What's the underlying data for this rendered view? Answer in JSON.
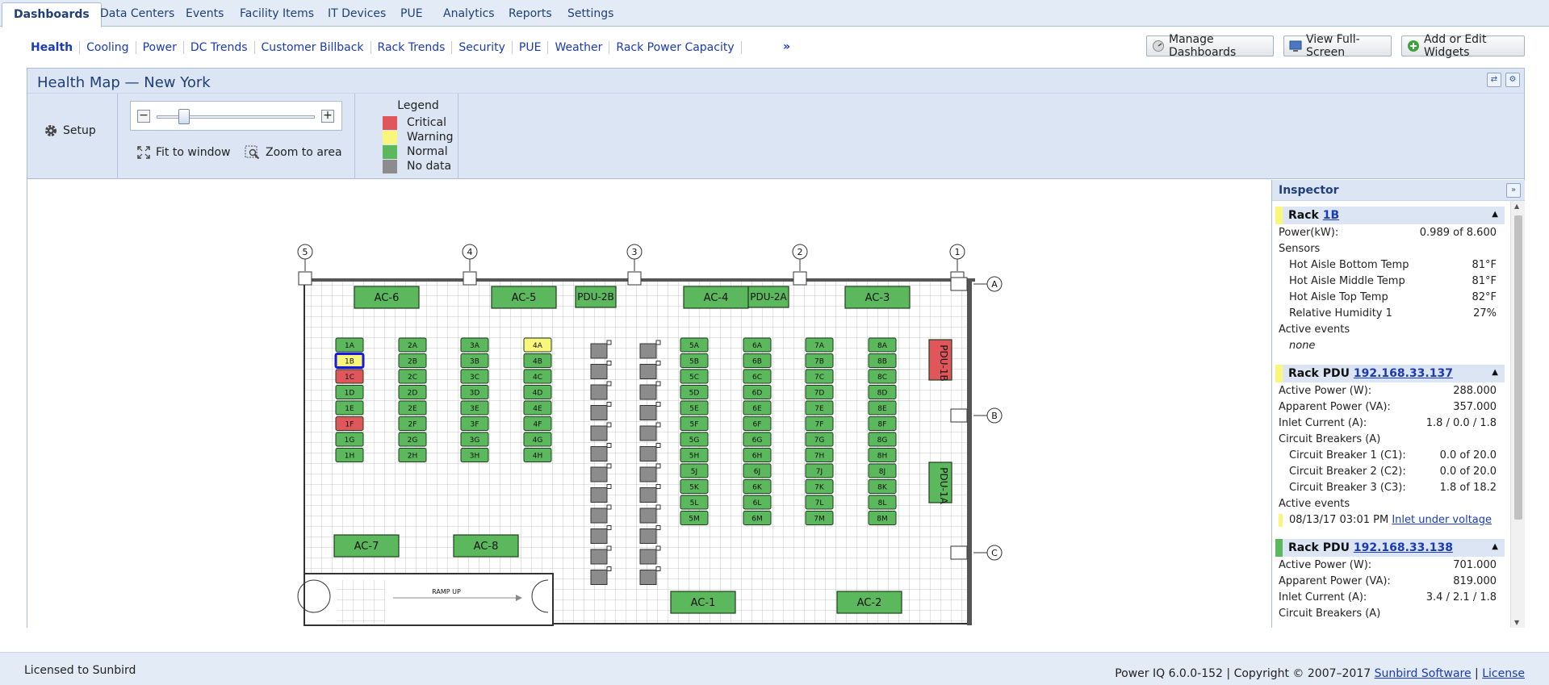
{
  "top_tabs": [
    "Dashboards",
    "Data Centers",
    "Events",
    "Facility Items",
    "IT Devices",
    "PUE",
    "Analytics",
    "Reports",
    "Settings"
  ],
  "sub_nav": [
    "Health",
    "Cooling",
    "Power",
    "DC Trends",
    "Customer Billback",
    "Rack Trends",
    "Security",
    "PUE",
    "Weather",
    "Rack Power Capacity"
  ],
  "sub_nav_more": "»",
  "buttons": {
    "manage": "Manage Dashboards",
    "fullscreen": "View Full-Screen",
    "widgets": "Add or Edit Widgets"
  },
  "panel": {
    "title": "Health Map — New York"
  },
  "toolbar": {
    "setup": "Setup",
    "fit": "Fit to window",
    "zoom_area": "Zoom to area",
    "zoom_minus": "−",
    "zoom_plus": "+",
    "zoom_level": 0.2
  },
  "legend": {
    "title": "Legend",
    "items": [
      {
        "label": "Critical",
        "color": "#e0565b"
      },
      {
        "label": "Warning",
        "color": "#f8f77c"
      },
      {
        "label": "Normal",
        "color": "#5cb85c"
      },
      {
        "label": "No data",
        "color": "#8c8c8c"
      }
    ]
  },
  "colors": {
    "critical": "#e0565b",
    "warning": "#f8f77c",
    "normal": "#5cb85c",
    "nodata": "#8c8c8c",
    "accent": "#1a3ab8",
    "border": "#a9bcd9"
  },
  "map": {
    "columns": [
      "5",
      "4",
      "3",
      "2",
      "1"
    ],
    "rows": [
      "A",
      "B",
      "C"
    ],
    "ac_units": [
      "AC-6",
      "AC-5",
      "AC-4",
      "AC-3",
      "AC-7",
      "AC-8",
      "AC-1",
      "AC-2"
    ],
    "pdus": [
      "PDU-2B",
      "PDU-2A",
      "PDU-1B",
      "PDU-1A"
    ],
    "ramp_label": "RAMP UP",
    "selected_rack": "1B",
    "rack_columns": [
      {
        "racks": [
          "1A",
          "1B",
          "1C",
          "1D",
          "1E",
          "1F",
          "1G",
          "1H"
        ],
        "status": [
          "normal",
          "warning",
          "critical",
          "normal",
          "normal",
          "critical",
          "normal",
          "normal"
        ]
      },
      {
        "racks": [
          "2A",
          "2B",
          "2C",
          "2D",
          "2E",
          "2F",
          "2G",
          "2H"
        ],
        "status": [
          "normal",
          "normal",
          "normal",
          "normal",
          "normal",
          "normal",
          "normal",
          "normal"
        ]
      },
      {
        "racks": [
          "3A",
          "3B",
          "3C",
          "3D",
          "3E",
          "3F",
          "3G",
          "3H"
        ],
        "status": [
          "normal",
          "normal",
          "normal",
          "normal",
          "normal",
          "normal",
          "normal",
          "normal"
        ]
      },
      {
        "racks": [
          "4A",
          "4B",
          "4C",
          "4D",
          "4E",
          "4F",
          "4G",
          "4H"
        ],
        "status": [
          "warning",
          "normal",
          "normal",
          "normal",
          "normal",
          "normal",
          "normal",
          "normal"
        ]
      },
      {
        "racks": [
          "5A",
          "5B",
          "5C",
          "5D",
          "5E",
          "5F",
          "5G",
          "5H",
          "5J",
          "5K",
          "5L",
          "5M"
        ],
        "status": [
          "normal",
          "normal",
          "normal",
          "normal",
          "normal",
          "normal",
          "normal",
          "normal",
          "normal",
          "normal",
          "normal",
          "normal"
        ]
      },
      {
        "racks": [
          "6A",
          "6B",
          "6C",
          "6D",
          "6E",
          "6F",
          "6G",
          "6H",
          "6J",
          "6K",
          "6L",
          "6M"
        ],
        "status": [
          "normal",
          "normal",
          "normal",
          "normal",
          "normal",
          "normal",
          "normal",
          "normal",
          "normal",
          "normal",
          "normal",
          "normal"
        ]
      },
      {
        "racks": [
          "7A",
          "7B",
          "7C",
          "7D",
          "7E",
          "7F",
          "7G",
          "7H",
          "7J",
          "7K",
          "7L",
          "7M"
        ],
        "status": [
          "normal",
          "normal",
          "normal",
          "normal",
          "normal",
          "normal",
          "normal",
          "normal",
          "normal",
          "normal",
          "normal",
          "normal"
        ]
      },
      {
        "racks": [
          "8A",
          "8B",
          "8C",
          "8D",
          "8E",
          "8F",
          "8G",
          "8H",
          "8J",
          "8K",
          "8L",
          "8M"
        ],
        "status": [
          "normal",
          "normal",
          "normal",
          "normal",
          "normal",
          "normal",
          "normal",
          "normal",
          "normal",
          "normal",
          "normal",
          "normal"
        ]
      }
    ]
  },
  "inspector": {
    "title": "Inspector",
    "collapse": "»",
    "rack": {
      "prefix": "Rack",
      "name": "1B",
      "status": "warning",
      "power_label": "Power(kW):",
      "power_value": "0.989 of 8.600",
      "sensors_label": "Sensors",
      "sensors": [
        {
          "k": "Hot Aisle Bottom Temp",
          "v": "81°F"
        },
        {
          "k": "Hot Aisle Middle Temp",
          "v": "81°F"
        },
        {
          "k": "Hot Aisle Top Temp",
          "v": "82°F"
        },
        {
          "k": "Relative Humidity 1",
          "v": "27%"
        }
      ],
      "events_label": "Active events",
      "events_none": "none"
    },
    "pdu1": {
      "prefix": "Rack PDU",
      "ip": "192.168.33.137",
      "status": "warning",
      "rows": [
        {
          "k": "Active Power (W):",
          "v": "288.000"
        },
        {
          "k": "Apparent Power (VA):",
          "v": "357.000"
        },
        {
          "k": "Inlet Current (A):",
          "v": "1.8 / 0.0 / 1.8"
        }
      ],
      "cb_label": "Circuit Breakers (A)",
      "breakers": [
        {
          "k": "Circuit Breaker 1 (C1):",
          "v": "0.0 of 20.0"
        },
        {
          "k": "Circuit Breaker 2 (C2):",
          "v": "0.0 of 20.0"
        },
        {
          "k": "Circuit Breaker 3 (C3):",
          "v": "1.8 of 18.2"
        }
      ],
      "events_label": "Active events",
      "event_time": "08/13/17 03:01 PM",
      "event_text": "Inlet under voltage"
    },
    "pdu2": {
      "prefix": "Rack PDU",
      "ip": "192.168.33.138",
      "status": "normal",
      "rows": [
        {
          "k": "Active Power (W):",
          "v": "701.000"
        },
        {
          "k": "Apparent Power (VA):",
          "v": "819.000"
        },
        {
          "k": "Inlet Current (A):",
          "v": "3.4 / 2.1 / 1.8"
        }
      ],
      "cb_label": "Circuit Breakers (A)"
    }
  },
  "footer": {
    "left": "Licensed to Sunbird",
    "version": "Power IQ 6.0.0-152 | Copyright © 2007–2017",
    "company": "Sunbird Software",
    "sep": "|",
    "license": "License"
  }
}
